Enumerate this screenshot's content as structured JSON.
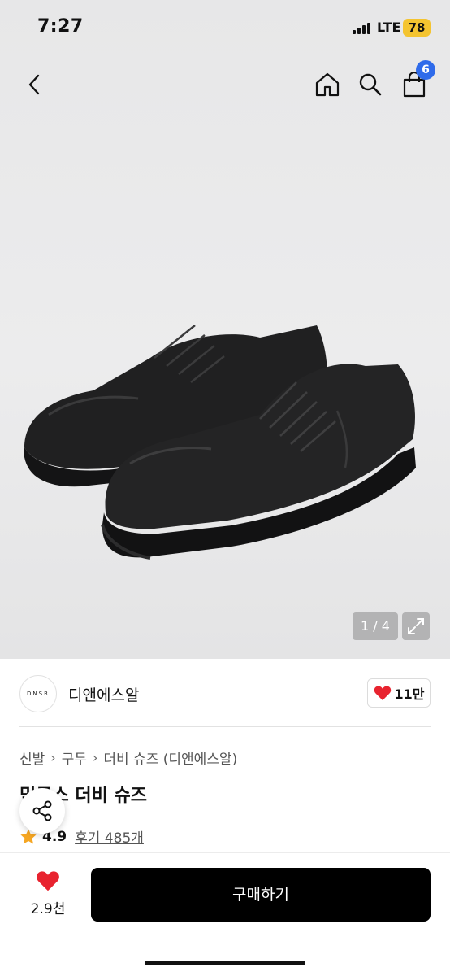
{
  "status_bar": {
    "time": "7:27",
    "network": "LTE",
    "battery": "78"
  },
  "nav": {
    "cart_count": "6"
  },
  "gallery": {
    "counter": "1 / 4"
  },
  "brand": {
    "logo_text": "DNSR",
    "name": "디앤에스알",
    "likes": "11만"
  },
  "breadcrumb": {
    "items": [
      "신발",
      "구두",
      "더비 슈즈 (디앤에스알)"
    ]
  },
  "product": {
    "title": "믹로스 더비 슈즈",
    "rating": "4.9",
    "reviews": "후기 485개"
  },
  "bottom_bar": {
    "wish_count": "2.9천",
    "buy_label": "구매하기"
  },
  "colors": {
    "accent_red": "#e8232f",
    "badge_blue": "#2f6bea",
    "star": "#f5a623",
    "buy_button": "#000000"
  }
}
